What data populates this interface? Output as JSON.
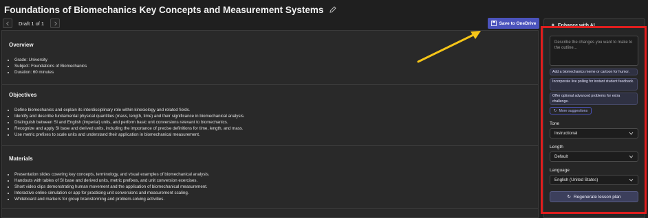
{
  "header": {
    "title": "Foundations of Biomechanics Key Concepts and Measurement Systems"
  },
  "toolbar": {
    "prev_icon": "chevron-left-icon",
    "draft_label": "Draft 1 of 1",
    "next_icon": "chevron-right-icon"
  },
  "save": {
    "label": "Save to OneDrive"
  },
  "sections": {
    "overview": {
      "title": "Overview",
      "items": [
        "Grade: University",
        "Subject: Foundations of Biomechanics",
        "Duration: 60 minutes"
      ]
    },
    "objectives": {
      "title": "Objectives",
      "items": [
        "Define biomechanics and explain its interdisciplinary role within kinesiology and related fields.",
        "Identify and describe fundamental physical quantities (mass, length, time) and their significance in biomechanical analysis.",
        "Distinguish between SI and English (imperial) units, and perform basic unit conversions relevant to biomechanics.",
        "Recognize and apply SI base and derived units, including the importance of precise definitions for time, length, and mass.",
        "Use metric prefixes to scale units and understand their application in biomechanical measurement."
      ]
    },
    "materials": {
      "title": "Materials",
      "items": [
        "Presentation slides covering key concepts, terminology, and visual examples of biomechanical analysis.",
        "Handouts with tables of SI base and derived units, metric prefixes, and unit conversion exercises.",
        "Short video clips demonstrating human movement and the application of biomechanical measurement.",
        "Interactive online simulation or app for practicing unit conversions and measurement scaling.",
        "Whiteboard and markers for group brainstorming and problem-solving activities."
      ]
    }
  },
  "panel": {
    "header": "Enhance with AI",
    "prompt_placeholder": "Describe the changes you want to make to the outline...",
    "suggestions": [
      "Add a biomechanics meme or cartoon for humor.",
      "Incorporate live polling for instant student feedback.",
      "Offer optional advanced problems for extra challenge."
    ],
    "more_label": "More suggestions",
    "tone": {
      "label": "Tone",
      "value": "Instructional"
    },
    "length": {
      "label": "Length",
      "value": "Default"
    },
    "language": {
      "label": "Language",
      "value": "English (United States)"
    },
    "regenerate_label": "Regenerate lesson plan"
  },
  "colors": {
    "accent": "#4b53bc",
    "highlight_frame": "#e11e1e",
    "arrow": "#f5c518"
  }
}
